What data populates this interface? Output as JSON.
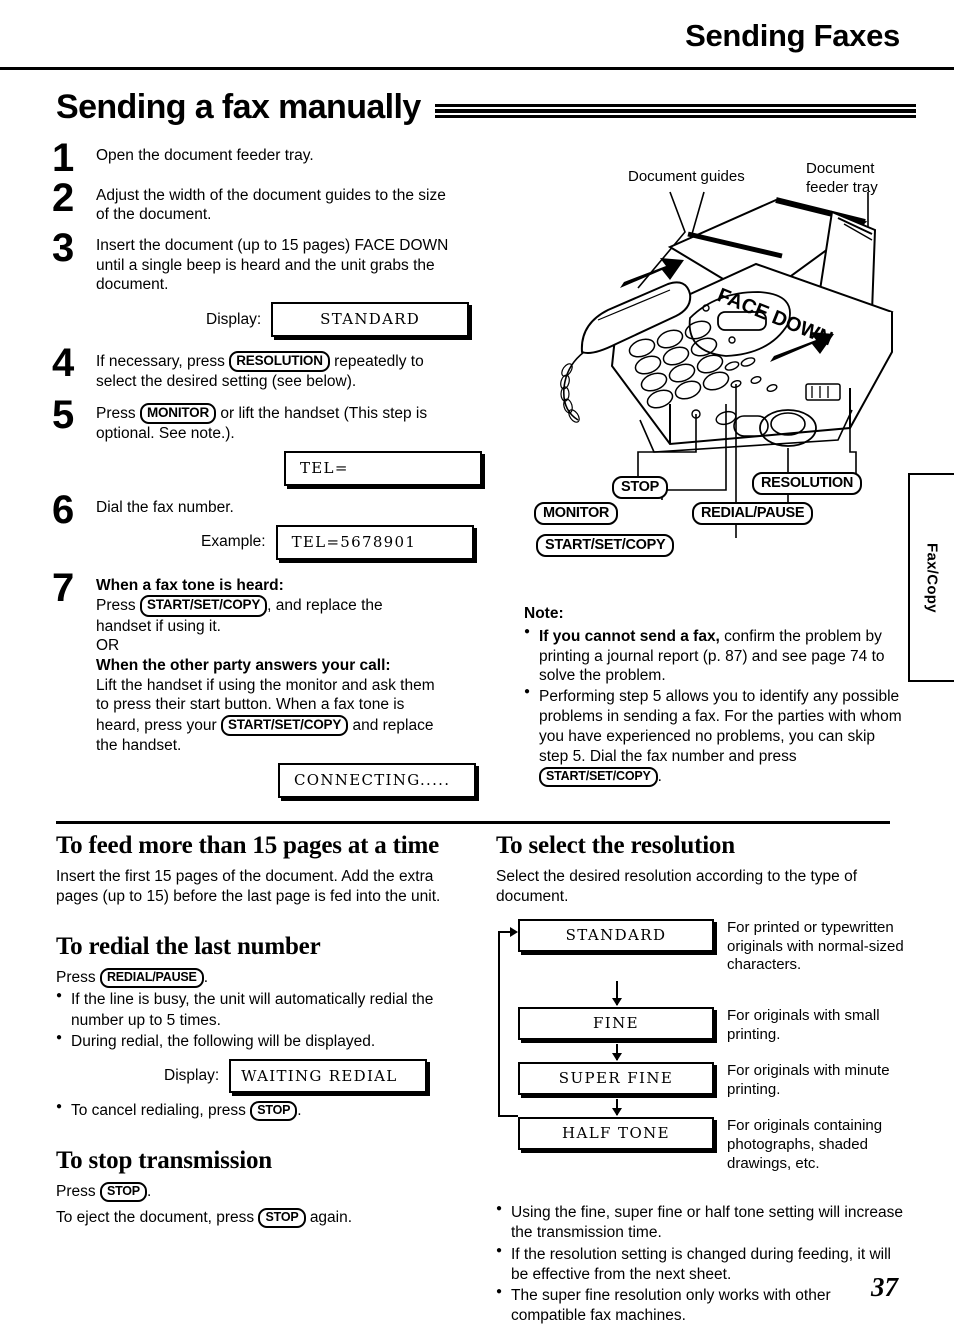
{
  "header": {
    "running_title": "Sending Faxes",
    "section_title": "Sending a fax manually"
  },
  "steps": [
    {
      "number": "1",
      "lines": [
        "Open the document feeder tray."
      ]
    },
    {
      "number": "2",
      "lines": [
        "Adjust the width of the document guides to the size",
        "of the document."
      ]
    },
    {
      "number": "3",
      "lines": [
        "Insert the document (up to 15 pages) FACE DOWN",
        "until a single beep is heard and the unit grabs the",
        "document."
      ],
      "display_label": "Display:",
      "display_value": "STANDARD"
    },
    {
      "number": "4",
      "pre": "If necessary, press",
      "key": "RESOLUTION",
      "post": "repeatedly to",
      "line2": "select the desired setting (see below)."
    },
    {
      "number": "5",
      "pre": "Press",
      "key": "MONITOR",
      "post": "or lift the handset (This step is",
      "line2": "optional. See note.).",
      "display_value": "TEL="
    },
    {
      "number": "6",
      "lines": [
        "Dial the fax number."
      ],
      "display_label": "Example:",
      "display_value": "TEL=5678901"
    },
    {
      "number": "7",
      "head1": "When a fax tone is heard:",
      "l1_pre": "Press",
      "l1_key": "START/SET/COPY",
      "l1_post": ", and replace the",
      "l2": "handset if using it.",
      "l3": "OR",
      "head2": "When the other party answers your call:",
      "l4": "Lift the handset if using the monitor and ask them",
      "l5": "to press their start button. When a fax tone is",
      "l6_pre": "heard, press your",
      "l6_key": "START/SET/COPY",
      "l6_post": "and replace",
      "l7": "the handset.",
      "display_value": "CONNECTING....."
    }
  ],
  "illustration": {
    "label_document_guides": "Document guides",
    "label_feeder_tray_l1": "Document",
    "label_feeder_tray_l2": "feeder tray",
    "label_face_down": "FACE DOWN",
    "buttons": {
      "stop": "STOP",
      "monitor": "MONITOR",
      "resolution": "RESOLUTION",
      "redial_pause": "REDIAL/PAUSE",
      "start_set_copy": "START/SET/COPY"
    }
  },
  "note": {
    "title": "Note:",
    "items": [
      {
        "bold": "If you cannot send a fax,",
        "rest": " confirm the problem by printing a journal report (p. 87) and see page 74 to solve the problem."
      },
      {
        "bold": "",
        "rest": "Performing step 5 allows you to identify any possible problems in sending a fax. For the parties with whom you have experienced no problems, you can skip step 5. Dial the fax number and press ",
        "key": "START/SET/COPY",
        "tail": "."
      }
    ]
  },
  "side_tab": {
    "label": "Fax/Copy"
  },
  "bottom_left": {
    "feed_heading": "To feed more than 15 pages at a time",
    "feed_body": "Insert the first 15 pages of the document. Add the extra pages (up to 15) before the last page is fed into the unit.",
    "redial_heading": "To redial the last number",
    "redial_press_pre": "Press",
    "redial_press_key": "REDIAL/PAUSE",
    "redial_press_post": ".",
    "redial_bullets": [
      "If the line is busy, the unit will automatically redial the number up to 5 times.",
      "During redial, the following will be displayed."
    ],
    "redial_display_label": "Display:",
    "redial_display_value": "WAITING REDIAL",
    "cancel_pre": "To cancel redialing, press",
    "cancel_key": "STOP",
    "cancel_post": ".",
    "stop_heading": "To stop transmission",
    "stop_press_pre": "Press",
    "stop_press_key": "STOP",
    "stop_press_post": ".",
    "stop_eject_pre": "To eject the document, press",
    "stop_eject_key": "STOP",
    "stop_eject_post": "again."
  },
  "bottom_right": {
    "heading": "To select the resolution",
    "intro": "Select the desired resolution according to the type of document.",
    "flow": [
      {
        "label": "STANDARD",
        "desc": "For printed or typewritten originals with normal-sized characters."
      },
      {
        "label": "FINE",
        "desc": "For originals with small printing."
      },
      {
        "label": "SUPER FINE",
        "desc": "For originals with minute printing."
      },
      {
        "label": "HALF TONE",
        "desc": "For originals containing photographs, shaded drawings, etc."
      }
    ],
    "bullets": [
      "Using the fine, super fine or half tone setting will increase the transmission time.",
      "If the resolution setting is changed during feeding, it will be effective from the next sheet.",
      "The super fine resolution only works with other compatible fax machines."
    ]
  },
  "page_number": "37"
}
